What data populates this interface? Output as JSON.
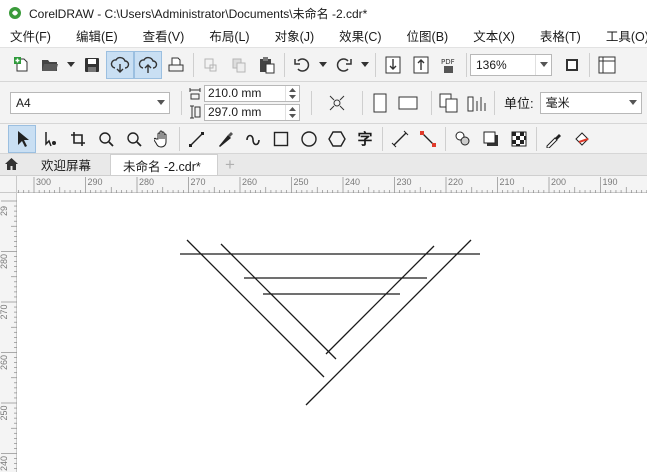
{
  "window": {
    "title": "CorelDRAW - C:\\Users\\Administrator\\Documents\\未命名 -2.cdr*"
  },
  "menu": [
    "文件(F)",
    "编辑(E)",
    "查看(V)",
    "布局(L)",
    "对象(J)",
    "效果(C)",
    "位图(B)",
    "文本(X)",
    "表格(T)",
    "工具(O)"
  ],
  "standard_toolbar": {
    "zoom": "136%"
  },
  "property_bar": {
    "page_size": "A4",
    "width": "210.0 mm",
    "height": "297.0 mm",
    "unit_label": "单位:",
    "unit_value": "毫米"
  },
  "toolbox_text_tool": "字",
  "tabs": {
    "welcome": "欢迎屏幕",
    "document": "未命名 -2.cdr*",
    "add": "+"
  },
  "ruler": {
    "horizontal": [
      "300",
      "290",
      "280",
      "270",
      "260",
      "250",
      "240",
      "230",
      "220",
      "210",
      "200",
      "190"
    ],
    "vertical": [
      "29",
      "280",
      "270",
      "260",
      "250",
      "240"
    ]
  },
  "colors": {
    "accent": "#2b6fb6",
    "active_button": "#c9dff3",
    "toolbar_bg": "#f3f3f3"
  }
}
